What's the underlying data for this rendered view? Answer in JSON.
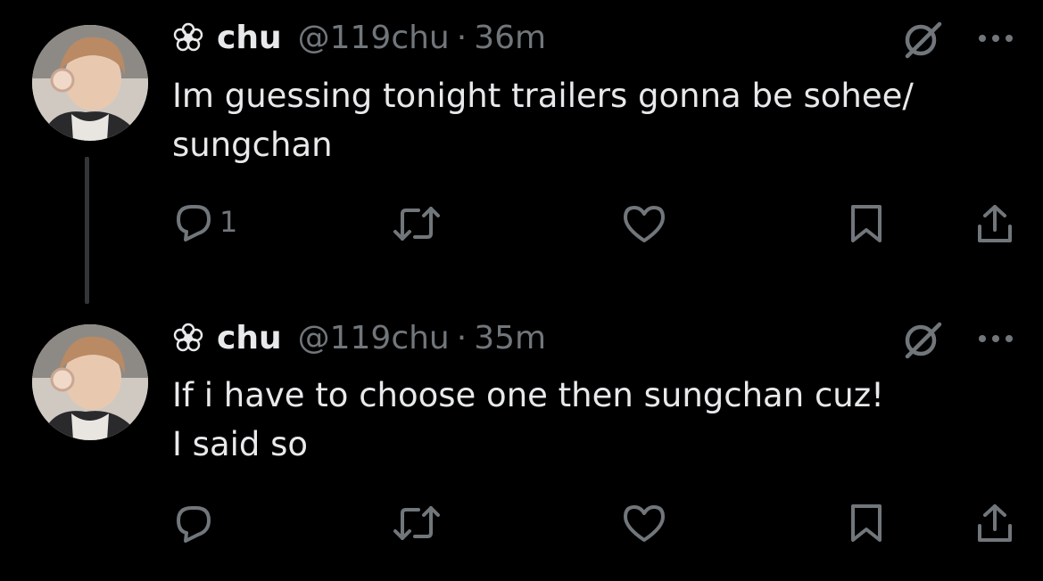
{
  "tweets": [
    {
      "author_name": "chu",
      "handle": "@119chu",
      "separator": "·",
      "time": "36m",
      "text_lines": [
        "Im guessing tonight trailers gonna be sohee/",
        "sungchan"
      ],
      "reply_count": "1"
    },
    {
      "author_name": "chu",
      "handle": "@119chu",
      "separator": "·",
      "time": "35m",
      "text_lines": [
        "If i have to choose one then sungchan cuz!",
        "I said so"
      ],
      "reply_count": ""
    }
  ],
  "icons": {
    "name_prefix": "flower-icon",
    "grok": "grok-icon",
    "more": "more-icon",
    "reply": "reply-icon",
    "retweet": "retweet-icon",
    "like": "like-icon",
    "bookmark": "bookmark-icon",
    "share": "share-icon"
  },
  "colors": {
    "background": "#000000",
    "primary_text": "#e7e9ea",
    "secondary_text": "#71767b",
    "thread_line": "#333639"
  }
}
